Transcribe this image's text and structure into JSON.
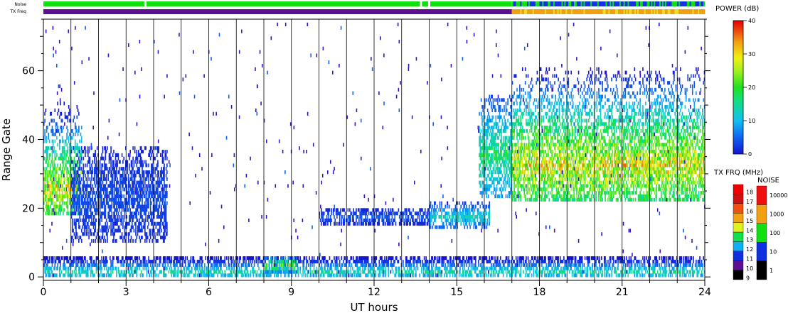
{
  "chart_data": {
    "type": "heatmap",
    "xlabel": "UT hours",
    "ylabel": "Range Gate",
    "xlim": [
      0,
      24
    ],
    "ylim": [
      -1,
      75
    ],
    "x_ticks": [
      0,
      3,
      6,
      9,
      12,
      15,
      18,
      21,
      24
    ],
    "x_tick_labels": [
      "0",
      "3",
      "6",
      "9",
      "12",
      "15",
      "18",
      "21",
      "24"
    ],
    "y_ticks": [
      0,
      20,
      40,
      60
    ],
    "y_tick_labels": [
      "0",
      "20",
      "40",
      "60"
    ],
    "hour_gridlines": true,
    "status_bars": {
      "noise_label": "Noise",
      "txfreq_label": "TX Freq",
      "noise_segments": [
        {
          "start": 0,
          "end": 17.0,
          "level": "low"
        },
        {
          "start": 17.0,
          "end": 24,
          "level": "mixed"
        }
      ],
      "txfreq_segments": [
        {
          "start": 0,
          "end": 17.0,
          "value_mhz": 10
        },
        {
          "start": 17.0,
          "end": 24,
          "value_mhz": 15
        }
      ],
      "gaps_hours": [
        3.7,
        13.7,
        14.0
      ]
    },
    "power_colorbar": {
      "title": "POWER (dB)",
      "min": 0,
      "max": 40,
      "ticks": [
        0,
        10,
        20,
        30,
        40
      ],
      "tick_labels": [
        "0",
        "10",
        "20",
        "30",
        "40"
      ]
    },
    "txfrq_colorbar": {
      "title": "TX FRQ (MHz)",
      "levels": [
        "9",
        "10",
        "11",
        "12",
        "13",
        "14",
        "15",
        "16",
        "17",
        "18"
      ],
      "colors": [
        "#000000",
        "#5a1090",
        "#1030e0",
        "#10b0f0",
        "#10e050",
        "#e0f020",
        "#f0a010",
        "#f05010",
        "#d01010",
        "#f00000"
      ]
    },
    "noise_colorbar": {
      "title": "NOISE",
      "levels": [
        "1",
        "10",
        "100",
        "1000",
        "10000"
      ],
      "colors": [
        "#000000",
        "#1030e0",
        "#10e010",
        "#f0a010",
        "#f01010"
      ]
    },
    "echo_regions": [
      {
        "t0": 0.0,
        "t1": 1.4,
        "g0": 18,
        "g1": 50,
        "peak_db": 35,
        "core_gate": 25
      },
      {
        "t0": 1.0,
        "t1": 4.5,
        "g0": 10,
        "g1": 37,
        "peak_db": 5,
        "core_gate": 22
      },
      {
        "t0": 0.0,
        "t1": 24.0,
        "g0": 0,
        "g1": 5,
        "peak_db": 18,
        "core_gate": 1
      },
      {
        "t0": 8.0,
        "t1": 9.2,
        "g0": 1,
        "g1": 5,
        "peak_db": 30,
        "core_gate": 3
      },
      {
        "t0": 10.0,
        "t1": 14.0,
        "g0": 15,
        "g1": 19,
        "peak_db": 6,
        "core_gate": 17
      },
      {
        "t0": 14.0,
        "t1": 16.2,
        "g0": 14,
        "g1": 21,
        "peak_db": 16,
        "core_gate": 17
      },
      {
        "t0": 15.8,
        "t1": 17.0,
        "g0": 23,
        "g1": 52,
        "peak_db": 22,
        "core_gate": 35
      },
      {
        "t0": 17.0,
        "t1": 24.0,
        "g0": 22,
        "g1": 60,
        "peak_db": 36,
        "core_gate": 32
      }
    ]
  }
}
